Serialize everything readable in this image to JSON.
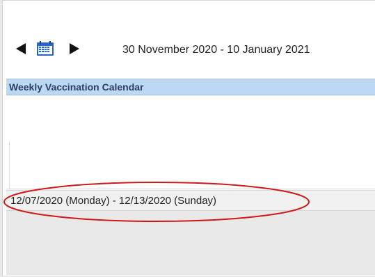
{
  "nav": {
    "prev_icon": "triangle-left-icon",
    "calendar_icon": "calendar-icon",
    "next_icon": "triangle-right-icon",
    "date_range": "30 November 2020  -  10 January 2021"
  },
  "section": {
    "title": "Weekly Vaccination Calendar"
  },
  "week": {
    "label": "12/07/2020 (Monday) - 12/13/2020 (Sunday)"
  },
  "colors": {
    "header_bg": "#bcd8f5",
    "header_text": "#2b3f66",
    "annotation": "#d0191b",
    "calendar_icon": "#2b63c9"
  }
}
